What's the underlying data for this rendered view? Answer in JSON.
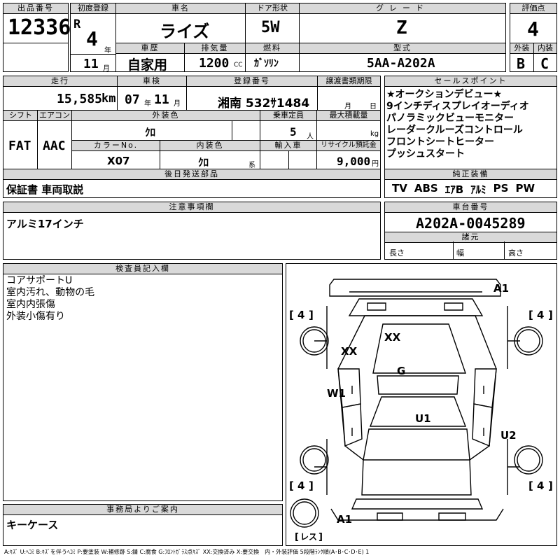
{
  "header": {
    "lot_no_label": "出品番号",
    "lot_no": "12336",
    "first_reg_label": "初度登録",
    "era": "R",
    "year": "4",
    "year_unit": "年",
    "month": "11",
    "month_unit": "月",
    "car_name_label": "車名",
    "car_name": "ライズ",
    "door_label": "ドア形状",
    "door": "5W",
    "grade_label": "グレード",
    "grade": "Z",
    "score_label": "評価点",
    "score": "4",
    "history_label": "車歴",
    "history": "自家用",
    "displacement_label": "排気量",
    "displacement": "1200",
    "cc": "CC",
    "fuel_label": "燃料",
    "fuel": "ｶﾞｿﾘﾝ",
    "model_label": "型式",
    "model": "5AA-A202A",
    "ext_label": "外装",
    "ext": "B",
    "int_label": "内装",
    "int": "C"
  },
  "row2": {
    "mileage_label": "走行",
    "mileage": "15,585",
    "km": "km",
    "inspection_label": "車検",
    "insp_year": "07",
    "insp_year_unit": "年",
    "insp_month": "11",
    "insp_month_unit": "月",
    "plate_label": "登録番号",
    "plate": "湘南 532ｻ1484",
    "transfer_label": "譲渡書類期限",
    "transfer_month": "月",
    "transfer_day": "日",
    "shift_label": "シフト",
    "shift": "FAT",
    "ac_label": "エアコン",
    "ac": "AAC",
    "ext_color_label": "外装色",
    "ext_color": "ｸﾛ",
    "capacity_label": "乗車定員",
    "capacity": "5",
    "capacity_unit": "人",
    "max_load_label": "最大積載量",
    "max_load_unit": "kg",
    "color_no_label": "カラーNo.",
    "color_no": "X07",
    "int_color_label": "内装色",
    "int_color": "ｸﾛ",
    "int_color_unit": "系",
    "import_label": "輸入車",
    "recycle_label": "リサイクル預託金",
    "recycle": "9,000",
    "recycle_unit": "円",
    "after_label": "後日発送部品",
    "after": "保証書 車両取説"
  },
  "sales_points": {
    "label": "セールスポイント",
    "items": [
      "★オークションデビュー★",
      "9インチディスプレイオーディオ",
      "パノラミックビューモニター",
      "レーダークルーズコントロール",
      "フロントシートヒーター",
      "プッシュスタート"
    ]
  },
  "equipment": {
    "label": "純正装備",
    "items": [
      "TV",
      "ABS",
      "ｴｱB",
      "ｱﾙﾐ",
      "PS",
      "PW"
    ]
  },
  "notes": {
    "label": "注意事項欄",
    "text": "アルミ17インチ"
  },
  "chassis": {
    "label": "車台番号",
    "value": "A202A-0045289",
    "spec_label": "諸元",
    "length_label": "長さ",
    "width_label": "幅",
    "height_label": "高さ"
  },
  "inspector": {
    "label": "検査員記入欄",
    "lines": [
      "コアサポートU",
      "室内汚れ、動物の毛",
      "室内内張傷",
      "外装小傷有り"
    ]
  },
  "diagram": {
    "marks": {
      "a1_top": "A1",
      "xx_roof": "XX",
      "xx_left": "XX",
      "g": "G",
      "w1": "W1",
      "u1": "U1",
      "u2": "U2",
      "a1_bottom": "A1",
      "tire_fl": "4",
      "tire_fr": "4",
      "tire_rl": "4",
      "tire_rr": "4",
      "spare": "レス"
    }
  },
  "office": {
    "label": "事務局よりご案内",
    "text": "キーケース"
  },
  "legend": "A:ｷｽﾞ U:ﾍｺﾐ B:ｷｽﾞを伴うﾍｺﾐ P:要塗装 W:補修跡 S:錆 C:腐食 G:ﾌﾛﾝﾄｶﾞﾗｽ点ｷｽﾞ XX:交換済み X:要交換　内・外装評価 5段階ﾗﾝｸ順(A･B･C･D･E) 1"
}
